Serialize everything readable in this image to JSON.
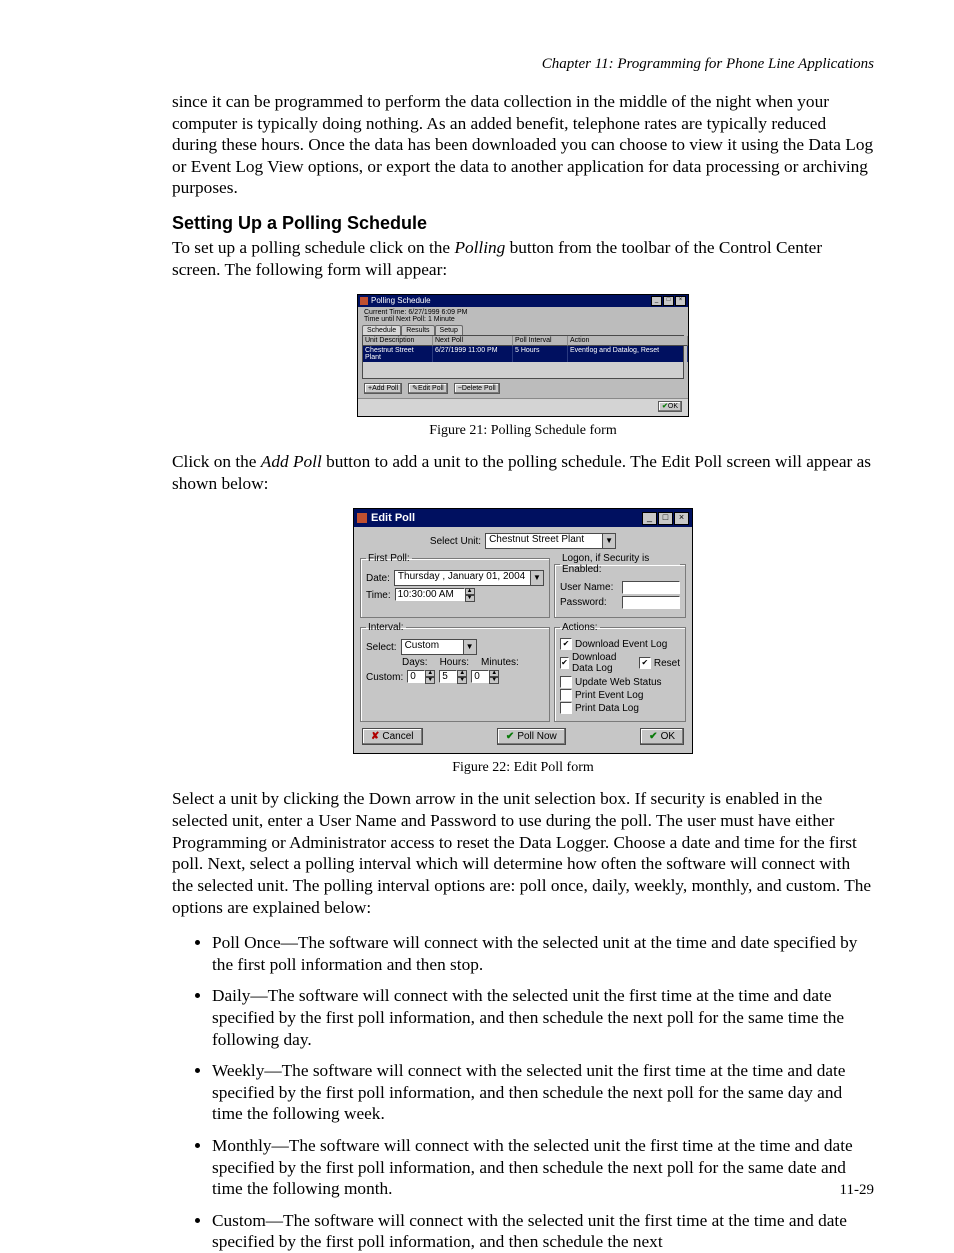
{
  "chapter_header": "Chapter 11: Programming for Phone Line Applications",
  "intro_para": "since it can be programmed to perform the data collection in the middle of the night when your computer is typically doing nothing. As  an added benefit, telephone rates are typically reduced during these hours. Once the data has been downloaded you can choose to view it using the Data Log or Event Log View options, or export the data to another application for data processing or archiving purposes.",
  "section_heading": "Setting Up a Polling Schedule",
  "setup_para_a": "To set up a polling schedule click on the ",
  "setup_para_b": "Polling",
  "setup_para_c": " button from the toolbar of the Control Center screen. The following form will appear:",
  "fig21_caption": "Figure 21: Polling Schedule form",
  "addpoll_para_a": "Click on the ",
  "addpoll_para_b": "Add Poll",
  "addpoll_para_c": " button to add a unit to the polling schedule. The Edit Poll screen will appear as shown below:",
  "fig22_caption": "Figure 22: Edit Poll form",
  "select_para": "Select a unit by clicking the Down arrow in the unit selection box. If security is enabled in the selected unit, enter a User Name and Password to use during the poll. The user must have either Programming or Administrator access to reset the Data Logger. Choose a date and time for the first poll. Next, select a polling interval which will determine how often the software will connect with the selected unit. The polling interval options are: poll once, daily, weekly, monthly, and custom. The options are explained below:",
  "bullets": [
    "Poll Once—The software will connect with the selected unit at the time and date specified by the first poll information and then stop.",
    "Daily—The software will connect with the selected unit the first time at the time and date specified by the first poll information, and then schedule the next poll for the same time the following day.",
    "Weekly—The software will connect with the selected unit the first time at the time and date specified by the first poll information, and then schedule the next poll for the same day and time the following week.",
    "Monthly—The software will connect with the selected unit the first time at the time and date specified by the first poll information, and then schedule the next poll for the same date and time the following month.",
    "Custom—The software will connect with the selected unit the first time at the time and date specified by the first poll information, and then schedule the next"
  ],
  "page_number": "11-29",
  "fig21": {
    "title": "Polling Schedule",
    "current_time_label": "Current Time:",
    "current_time_value": "6/27/1999 6:09 PM",
    "time_until_label": "Time until Next Poll:",
    "time_until_value": "1 Minute",
    "tabs": [
      "Schedule",
      "Results",
      "Setup"
    ],
    "columns": [
      "Unit Description",
      "Next Poll",
      "Poll Interval",
      "Action"
    ],
    "row": [
      "Chestnut Street Plant",
      "6/27/1999 11:00 PM",
      "5 Hours",
      "Eventlog and Datalog, Reset"
    ],
    "buttons": {
      "add": "Add Poll",
      "edit": "Edit Poll",
      "delete": "Delete Poll",
      "ok": "OK"
    }
  },
  "fig22": {
    "title": "Edit Poll",
    "select_unit_label": "Select Unit:",
    "select_unit_value": "Chestnut Street Plant",
    "first_poll": {
      "legend": "First Poll:",
      "date_label": "Date:",
      "date_value": "Thursday ,  January  01, 2004",
      "time_label": "Time:",
      "time_value": "10:30:00 AM"
    },
    "logon": {
      "legend": "Logon, if Security is Enabled:",
      "user_label": "User Name:",
      "user_value": "",
      "pass_label": "Password:",
      "pass_value": ""
    },
    "interval": {
      "legend": "Interval:",
      "select_label": "Select:",
      "select_value": "Custom",
      "days_label": "Days:",
      "hours_label": "Hours:",
      "minutes_label": "Minutes:",
      "custom_label": "Custom:",
      "days_value": "0",
      "hours_value": "5",
      "minutes_value": "0"
    },
    "actions": {
      "legend": "Actions:",
      "download_event": "Download Event Log",
      "download_data": "Download Data Log",
      "reset": "Reset",
      "update_web": "Update Web Status",
      "print_event": "Print Event Log",
      "print_data": "Print Data Log"
    },
    "buttons": {
      "cancel": "Cancel",
      "pollnow": "Poll Now",
      "ok": "OK"
    }
  }
}
